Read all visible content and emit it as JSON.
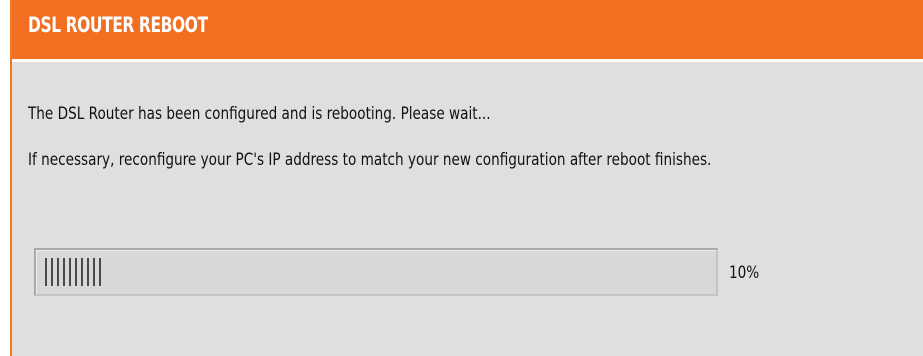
{
  "header": {
    "title": "DSL ROUTER REBOOT"
  },
  "message": {
    "line1": "The DSL Router has been configured and is rebooting. Please wait...",
    "line2": "If necessary, reconfigure your PC's IP address to match your new configuration after reboot finishes."
  },
  "progress": {
    "percent": 10,
    "label": "10%"
  },
  "colors": {
    "header_bg": "#f26f21",
    "panel_bg": "#dfdfdf",
    "text": "#111111"
  }
}
